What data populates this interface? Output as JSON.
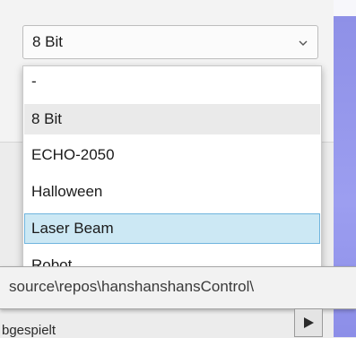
{
  "combo": {
    "selected_value": "8 Bit",
    "chevron_icon": "chevron-down-icon"
  },
  "dropdown": {
    "items": [
      {
        "label": "-"
      },
      {
        "label": "8 Bit",
        "state": "selected"
      },
      {
        "label": "ECHO-2050"
      },
      {
        "label": "Halloween"
      },
      {
        "label": "Laser Beam",
        "state": "hover"
      },
      {
        "label": "Robot"
      }
    ]
  },
  "tooltip": {
    "text": "source\\repos\\hanshanshansControl\\"
  },
  "status": {
    "text": "bgespielt",
    "play_icon": "play-icon"
  },
  "colors": {
    "hover_bg": "#cce8f4",
    "hover_border": "#6fb4de",
    "selected_bg": "#eaeaea",
    "accent": "#9c9ef0"
  }
}
